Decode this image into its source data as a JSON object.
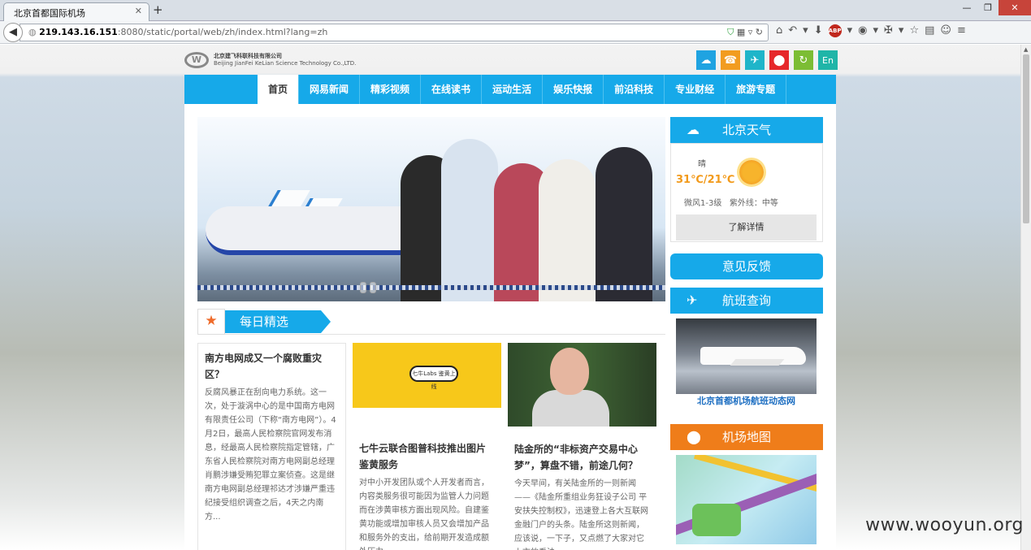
{
  "browser": {
    "tab_title": "北京首都国际机场",
    "tab_close": "✕",
    "new_tab": "+",
    "url_host": "219.143.16.151",
    "url_rest": ":8080/static/portal/web/zh/index.html?lang=zh",
    "window_buttons": [
      "—",
      "❐",
      "✕"
    ]
  },
  "logo": {
    "mark": "W",
    "name_zh": "北京建飞科联科技有限公司",
    "name_en": "Beijing JianFei KeLian Science Technology Co.,LTD."
  },
  "top_icons": [
    {
      "icon": "cloud-icon",
      "glyph": "☁"
    },
    {
      "icon": "phone-icon",
      "glyph": "☎"
    },
    {
      "icon": "plane-icon",
      "glyph": "✈"
    },
    {
      "icon": "location-icon",
      "glyph": "⬤"
    },
    {
      "icon": "refresh-icon",
      "glyph": "↻"
    },
    {
      "icon": "english-icon",
      "glyph": "En"
    }
  ],
  "nav": {
    "items": [
      "首页",
      "网易新闻",
      "精彩视频",
      "在线读书",
      "运动生活",
      "娱乐快报",
      "前沿科技",
      "专业财经",
      "旅游专题"
    ],
    "active": "首页"
  },
  "daily": {
    "title": "每日精选",
    "articles": [
      {
        "title": "南方电网成又一个腐败重灾区？",
        "body": "反腐风暴正在刮向电力系统。这一次，处于漩涡中心的是中国南方电网有限责任公司（下称“南方电网”）。4月2日，最高人民检察院官网发布消息，经最高人民检察院指定管辖，广东省人民检察院对南方电网副总经理肖鹏涉嫌受贿犯罪立案侦查。这是继南方电网副总经理祁达才涉嫌严重违纪接受组织调查之后，4天之内南方..."
      },
      {
        "title": "七牛云联合图普科技推出图片鉴黄服务",
        "image_text": "七牛Labs 鉴黄上线",
        "body": "对中小开发团队或个人开发者而言，内容类服务很可能因为监管人力问题而在涉黄审核方面出现风险。自建鉴黄功能或增加审核人员又会增加产品和服务外的支出，给前期开发造成额外压力。"
      },
      {
        "title": "陆金所的“非标资产交易中心梦”，算盘不错，前途几何？",
        "body": "今天早间，有关陆金所的一则新闻——《陆金所重组业务狂设子公司 平安扶失控制权》，迅速登上各大互联网金融门户的头条。陆金所这则新闻，应该说，一下子，又点燃了大家对它上市的看法。"
      }
    ]
  },
  "weather": {
    "title": "北京天气",
    "condition": "晴",
    "temperature": "31℃/21℃",
    "wind": "微风1-3级",
    "uv": "紫外线：中等",
    "more": "了解详情"
  },
  "feedback": {
    "label": "意见反馈"
  },
  "flight": {
    "title": "航班查询",
    "caption": "北京首都机场航班动态网"
  },
  "map": {
    "title": "机场地图"
  },
  "watermark": "www.wooyun.org",
  "colors": {
    "accent": "#16a9e9",
    "orange": "#ef7d1a",
    "temp": "#f29a1b"
  }
}
